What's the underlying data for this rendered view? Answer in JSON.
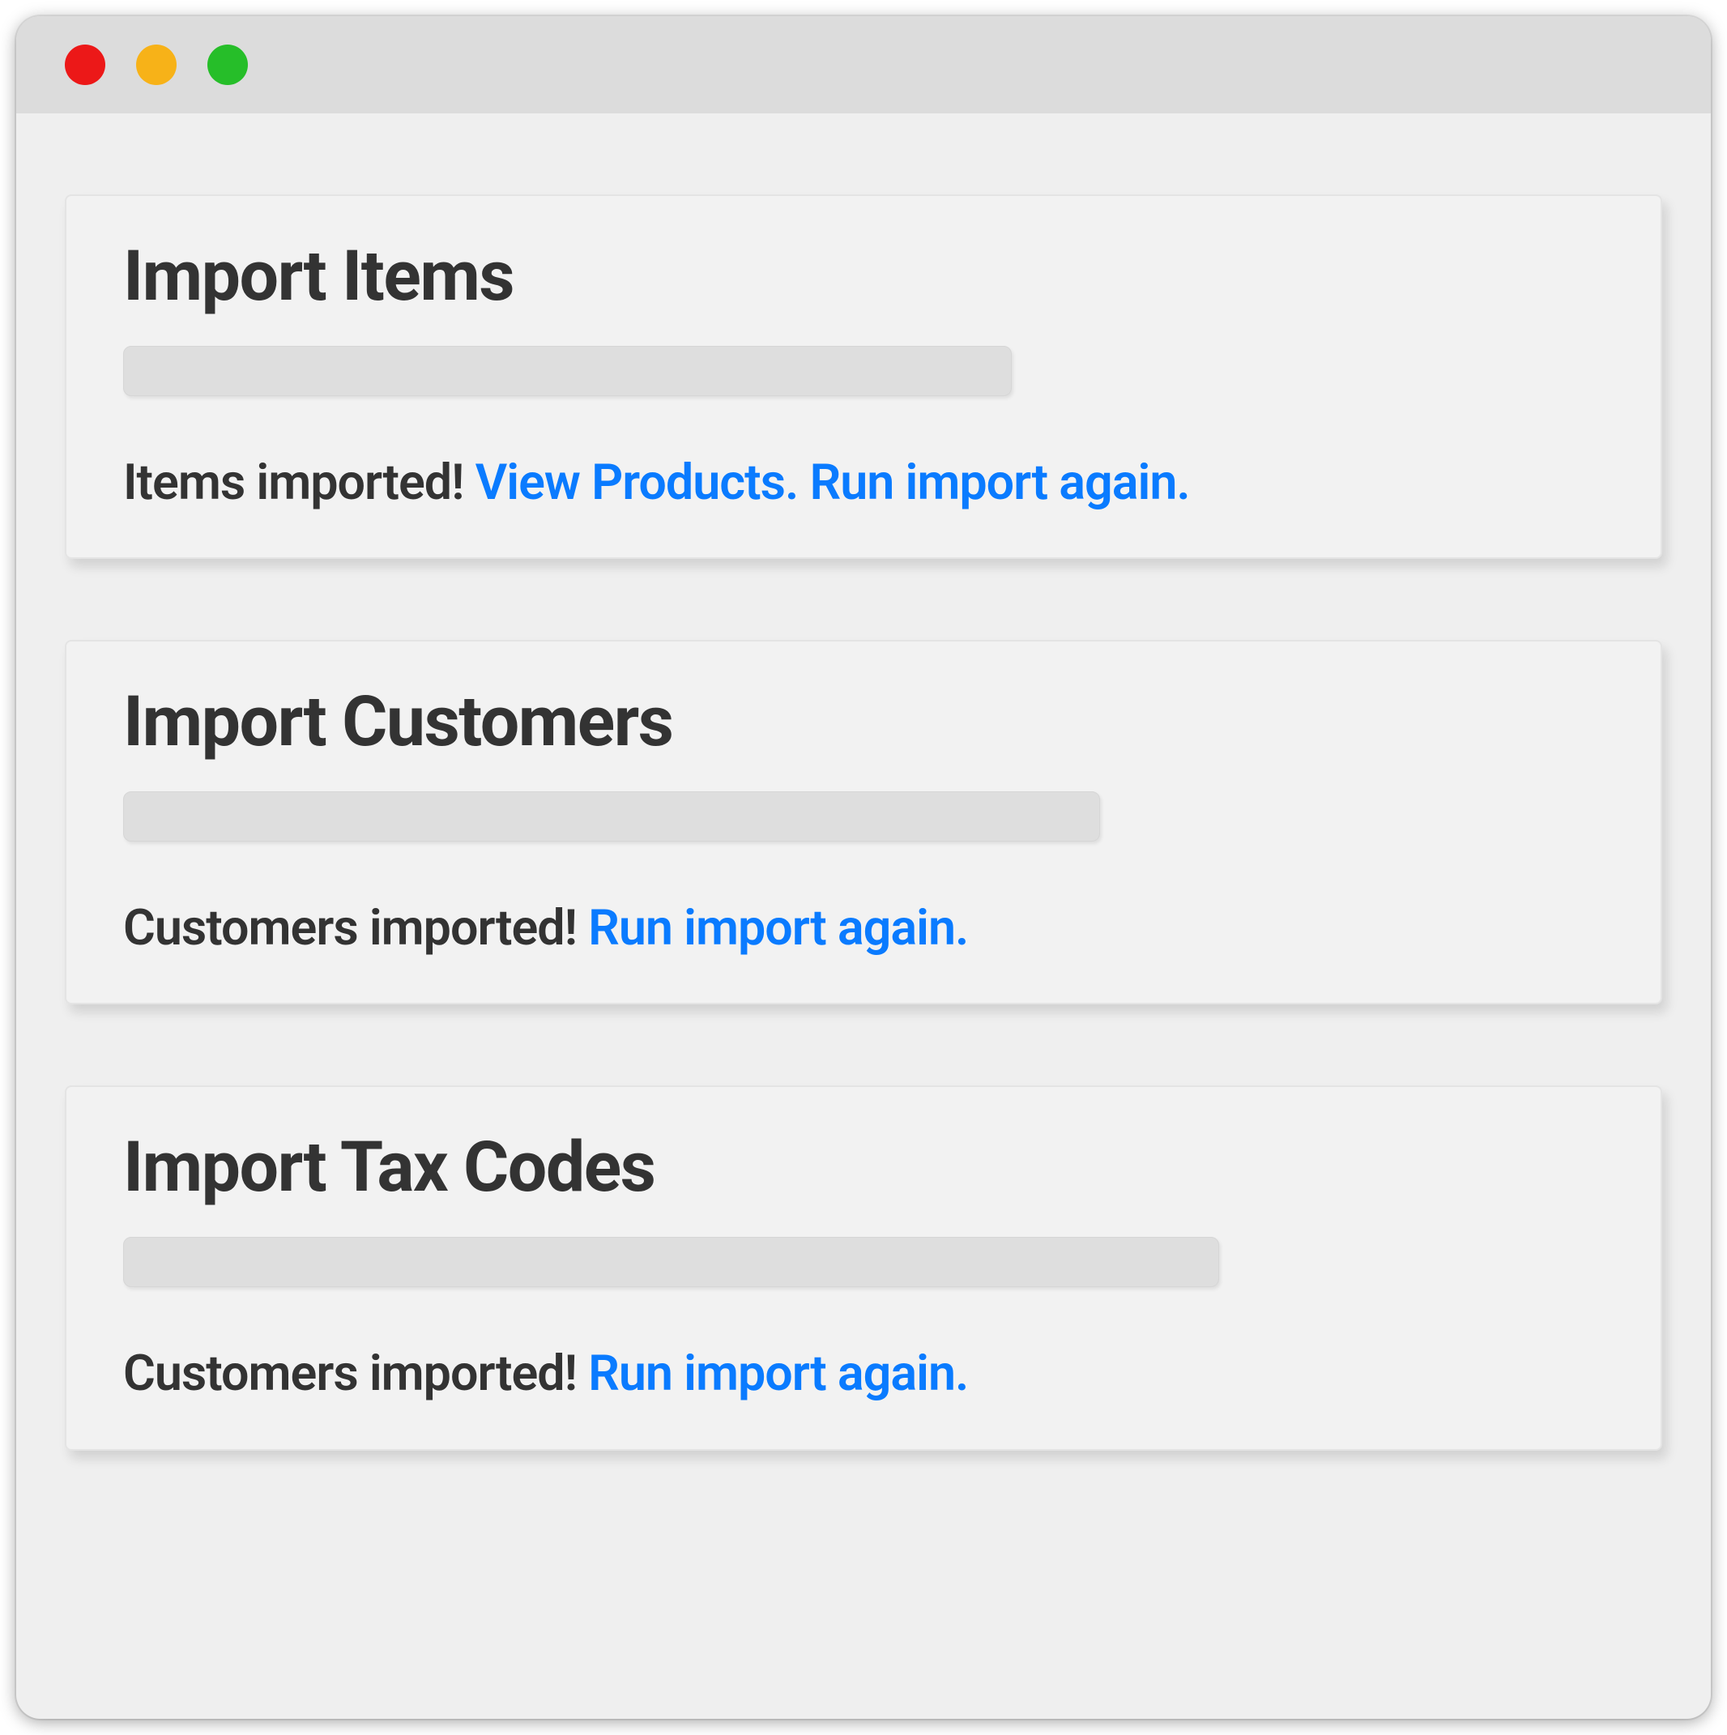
{
  "cards": [
    {
      "title": "Import Items",
      "status": "Items imported!",
      "links": [
        "View Products.",
        "Run import again."
      ]
    },
    {
      "title": "Import Customers",
      "status": "Customers imported!",
      "links": [
        "Run import again."
      ]
    },
    {
      "title": "Import Tax Codes",
      "status": "Customers imported!",
      "links": [
        "Run import again."
      ]
    }
  ]
}
